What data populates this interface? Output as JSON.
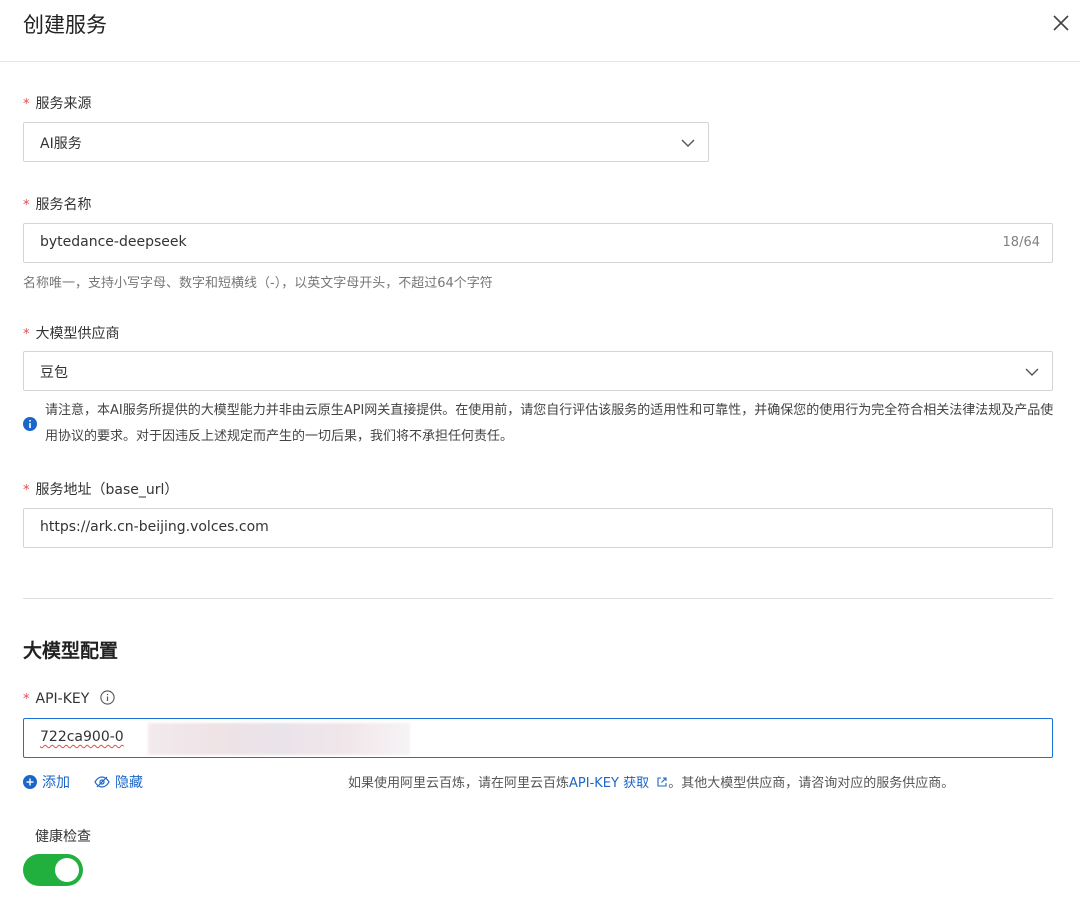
{
  "dialog": {
    "title": "创建服务"
  },
  "form": {
    "service_source": {
      "label": "服务来源",
      "value": "AI服务"
    },
    "service_name": {
      "label": "服务名称",
      "value": "bytedance-deepseek",
      "counter": "18/64",
      "hint": "名称唯一，支持小写字母、数字和短横线（-），以英文字母开头，不超过64个字符"
    },
    "provider": {
      "label": "大模型供应商",
      "value": "豆包",
      "notice": "请注意，本AI服务所提供的大模型能力并非由云原生API网关直接提供。在使用前，请您自行评估该服务的适用性和可靠性，并确保您的使用行为完全符合相关法律法规及产品使用协议的要求。对于因违反上述规定而产生的一切后果，我们将不承担任何责任。"
    },
    "base_url": {
      "label": "服务地址（base_url）",
      "value": "https://ark.cn-beijing.volces.com"
    }
  },
  "model_config": {
    "section_title": "大模型配置",
    "api_key": {
      "label": "API-KEY",
      "value": "722ca900-0"
    },
    "add_label": "添加",
    "hide_label": "隐藏",
    "hint_prefix": "如果使用阿里云百炼，请在阿里云百炼",
    "hint_link": "API-KEY 获取",
    "hint_suffix": "。其他大模型供应商，请咨询对应的服务供应商。"
  },
  "health_check": {
    "label": "健康检查",
    "enabled": true
  },
  "colors": {
    "accent": "#1b66c9",
    "required": "#e5484d",
    "toggle_on": "#21b03d"
  }
}
